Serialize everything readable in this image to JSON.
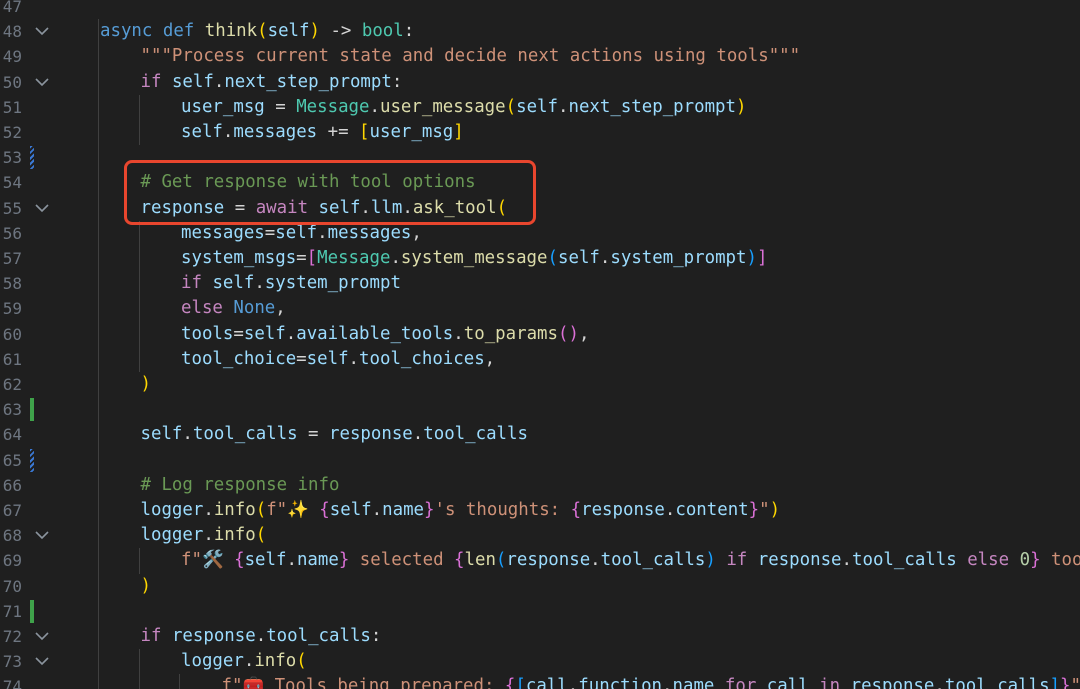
{
  "editor": {
    "language": "python",
    "colors": {
      "background": "#1f1f1f",
      "highlight_box": "#e8462e",
      "added_marker": "#3fa24a",
      "modified_marker": "#3a78d4"
    },
    "lines": [
      {
        "no": "47",
        "indent": 0,
        "fold": false,
        "marker": "",
        "tokens": []
      },
      {
        "no": "48",
        "indent": 0,
        "fold": true,
        "marker": "",
        "tokens": [
          {
            "t": "async",
            "c": "kw"
          },
          {
            "t": " "
          },
          {
            "t": "def",
            "c": "kw"
          },
          {
            "t": " "
          },
          {
            "t": "think",
            "c": "fn"
          },
          {
            "t": "(",
            "c": "b1"
          },
          {
            "t": "self",
            "c": "var"
          },
          {
            "t": ")",
            "c": "b1"
          },
          {
            "t": " -> "
          },
          {
            "t": "bool",
            "c": "cls"
          },
          {
            "t": ":"
          }
        ]
      },
      {
        "no": "49",
        "indent": 1,
        "fold": false,
        "marker": "",
        "tokens": [
          {
            "t": "\"\"\"Process current state and decide next actions using tools\"\"\"",
            "c": "str"
          }
        ]
      },
      {
        "no": "50",
        "indent": 1,
        "fold": true,
        "marker": "",
        "tokens": [
          {
            "t": "if",
            "c": "ctrl"
          },
          {
            "t": " "
          },
          {
            "t": "self",
            "c": "var"
          },
          {
            "t": "."
          },
          {
            "t": "next_step_prompt",
            "c": "var"
          },
          {
            "t": ":"
          }
        ]
      },
      {
        "no": "51",
        "indent": 2,
        "fold": false,
        "marker": "",
        "tokens": [
          {
            "t": "user_msg",
            "c": "var"
          },
          {
            "t": " = "
          },
          {
            "t": "Message",
            "c": "cls"
          },
          {
            "t": "."
          },
          {
            "t": "user_message",
            "c": "fn"
          },
          {
            "t": "(",
            "c": "b1"
          },
          {
            "t": "self",
            "c": "var"
          },
          {
            "t": "."
          },
          {
            "t": "next_step_prompt",
            "c": "var"
          },
          {
            "t": ")",
            "c": "b1"
          }
        ]
      },
      {
        "no": "52",
        "indent": 2,
        "fold": false,
        "marker": "",
        "tokens": [
          {
            "t": "self",
            "c": "var"
          },
          {
            "t": "."
          },
          {
            "t": "messages",
            "c": "var"
          },
          {
            "t": " += "
          },
          {
            "t": "[",
            "c": "b1"
          },
          {
            "t": "user_msg",
            "c": "var"
          },
          {
            "t": "]",
            "c": "b1"
          }
        ]
      },
      {
        "no": "53",
        "indent": 0,
        "fold": false,
        "marker": "modified",
        "tokens": []
      },
      {
        "no": "54",
        "indent": 1,
        "fold": false,
        "marker": "",
        "tokens": [
          {
            "t": "# Get response with tool options",
            "c": "cmt"
          }
        ]
      },
      {
        "no": "55",
        "indent": 1,
        "fold": true,
        "marker": "",
        "tokens": [
          {
            "t": "response",
            "c": "var"
          },
          {
            "t": " = "
          },
          {
            "t": "await",
            "c": "ctrl"
          },
          {
            "t": " "
          },
          {
            "t": "self",
            "c": "var"
          },
          {
            "t": "."
          },
          {
            "t": "llm",
            "c": "var"
          },
          {
            "t": "."
          },
          {
            "t": "ask_tool",
            "c": "fn"
          },
          {
            "t": "(",
            "c": "b1"
          }
        ]
      },
      {
        "no": "56",
        "indent": 2,
        "fold": false,
        "marker": "",
        "tokens": [
          {
            "t": "messages",
            "c": "var"
          },
          {
            "t": "="
          },
          {
            "t": "self",
            "c": "var"
          },
          {
            "t": "."
          },
          {
            "t": "messages",
            "c": "var"
          },
          {
            "t": ","
          }
        ]
      },
      {
        "no": "57",
        "indent": 2,
        "fold": false,
        "marker": "",
        "tokens": [
          {
            "t": "system_msgs",
            "c": "var"
          },
          {
            "t": "="
          },
          {
            "t": "[",
            "c": "b2"
          },
          {
            "t": "Message",
            "c": "cls"
          },
          {
            "t": "."
          },
          {
            "t": "system_message",
            "c": "fn"
          },
          {
            "t": "(",
            "c": "b3"
          },
          {
            "t": "self",
            "c": "var"
          },
          {
            "t": "."
          },
          {
            "t": "system_prompt",
            "c": "var"
          },
          {
            "t": ")",
            "c": "b3"
          },
          {
            "t": "]",
            "c": "b2"
          }
        ]
      },
      {
        "no": "58",
        "indent": 2,
        "fold": false,
        "marker": "",
        "tokens": [
          {
            "t": "if",
            "c": "ctrl"
          },
          {
            "t": " "
          },
          {
            "t": "self",
            "c": "var"
          },
          {
            "t": "."
          },
          {
            "t": "system_prompt",
            "c": "var"
          }
        ]
      },
      {
        "no": "59",
        "indent": 2,
        "fold": false,
        "marker": "",
        "tokens": [
          {
            "t": "else",
            "c": "ctrl"
          },
          {
            "t": " "
          },
          {
            "t": "None",
            "c": "kw"
          },
          {
            "t": ","
          }
        ]
      },
      {
        "no": "60",
        "indent": 2,
        "fold": false,
        "marker": "",
        "tokens": [
          {
            "t": "tools",
            "c": "var"
          },
          {
            "t": "="
          },
          {
            "t": "self",
            "c": "var"
          },
          {
            "t": "."
          },
          {
            "t": "available_tools",
            "c": "var"
          },
          {
            "t": "."
          },
          {
            "t": "to_params",
            "c": "fn"
          },
          {
            "t": "(",
            "c": "b2"
          },
          {
            "t": ")",
            "c": "b2"
          },
          {
            "t": ","
          }
        ]
      },
      {
        "no": "61",
        "indent": 2,
        "fold": false,
        "marker": "",
        "tokens": [
          {
            "t": "tool_choice",
            "c": "var"
          },
          {
            "t": "="
          },
          {
            "t": "self",
            "c": "var"
          },
          {
            "t": "."
          },
          {
            "t": "tool_choices",
            "c": "var"
          },
          {
            "t": ","
          }
        ]
      },
      {
        "no": "62",
        "indent": 1,
        "fold": false,
        "marker": "",
        "tokens": [
          {
            "t": ")",
            "c": "b1"
          }
        ]
      },
      {
        "no": "63",
        "indent": 0,
        "fold": false,
        "marker": "added",
        "tokens": []
      },
      {
        "no": "64",
        "indent": 1,
        "fold": false,
        "marker": "",
        "tokens": [
          {
            "t": "self",
            "c": "var"
          },
          {
            "t": "."
          },
          {
            "t": "tool_calls",
            "c": "var"
          },
          {
            "t": " = "
          },
          {
            "t": "response",
            "c": "var"
          },
          {
            "t": "."
          },
          {
            "t": "tool_calls",
            "c": "var"
          }
        ]
      },
      {
        "no": "65",
        "indent": 0,
        "fold": false,
        "marker": "modified",
        "tokens": []
      },
      {
        "no": "66",
        "indent": 1,
        "fold": false,
        "marker": "",
        "tokens": [
          {
            "t": "# Log response info",
            "c": "cmt"
          }
        ]
      },
      {
        "no": "67",
        "indent": 1,
        "fold": false,
        "marker": "",
        "tokens": [
          {
            "t": "logger",
            "c": "var"
          },
          {
            "t": "."
          },
          {
            "t": "info",
            "c": "fn"
          },
          {
            "t": "(",
            "c": "b1"
          },
          {
            "t": "f\"✨ ",
            "c": "str"
          },
          {
            "t": "{",
            "c": "b2"
          },
          {
            "t": "self",
            "c": "var"
          },
          {
            "t": "."
          },
          {
            "t": "name",
            "c": "var"
          },
          {
            "t": "}",
            "c": "b2"
          },
          {
            "t": "'s thoughts: ",
            "c": "str"
          },
          {
            "t": "{",
            "c": "b2"
          },
          {
            "t": "response",
            "c": "var"
          },
          {
            "t": "."
          },
          {
            "t": "content",
            "c": "var"
          },
          {
            "t": "}",
            "c": "b2"
          },
          {
            "t": "\"",
            "c": "str"
          },
          {
            "t": ")",
            "c": "b1"
          }
        ]
      },
      {
        "no": "68",
        "indent": 1,
        "fold": true,
        "marker": "",
        "tokens": [
          {
            "t": "logger",
            "c": "var"
          },
          {
            "t": "."
          },
          {
            "t": "info",
            "c": "fn"
          },
          {
            "t": "(",
            "c": "b1"
          }
        ]
      },
      {
        "no": "69",
        "indent": 2,
        "fold": false,
        "marker": "",
        "tokens": [
          {
            "t": "f\"🛠️ ",
            "c": "str"
          },
          {
            "t": "{",
            "c": "b2"
          },
          {
            "t": "self",
            "c": "var"
          },
          {
            "t": "."
          },
          {
            "t": "name",
            "c": "var"
          },
          {
            "t": "}",
            "c": "b2"
          },
          {
            "t": " selected ",
            "c": "str"
          },
          {
            "t": "{",
            "c": "b2"
          },
          {
            "t": "len",
            "c": "fn"
          },
          {
            "t": "(",
            "c": "b3"
          },
          {
            "t": "response",
            "c": "var"
          },
          {
            "t": "."
          },
          {
            "t": "tool_calls",
            "c": "var"
          },
          {
            "t": ")",
            "c": "b3"
          },
          {
            "t": " "
          },
          {
            "t": "if",
            "c": "ctrl"
          },
          {
            "t": " "
          },
          {
            "t": "response",
            "c": "var"
          },
          {
            "t": "."
          },
          {
            "t": "tool_calls",
            "c": "var"
          },
          {
            "t": " "
          },
          {
            "t": "else",
            "c": "ctrl"
          },
          {
            "t": " "
          },
          {
            "t": "0",
            "c": "num"
          },
          {
            "t": "}",
            "c": "b2"
          },
          {
            "t": " tools t",
            "c": "str"
          }
        ]
      },
      {
        "no": "70",
        "indent": 1,
        "fold": false,
        "marker": "",
        "tokens": [
          {
            "t": ")",
            "c": "b1"
          }
        ]
      },
      {
        "no": "71",
        "indent": 0,
        "fold": false,
        "marker": "added",
        "tokens": []
      },
      {
        "no": "72",
        "indent": 1,
        "fold": true,
        "marker": "",
        "tokens": [
          {
            "t": "if",
            "c": "ctrl"
          },
          {
            "t": " "
          },
          {
            "t": "response",
            "c": "var"
          },
          {
            "t": "."
          },
          {
            "t": "tool_calls",
            "c": "var"
          },
          {
            "t": ":"
          }
        ]
      },
      {
        "no": "73",
        "indent": 2,
        "fold": true,
        "marker": "",
        "tokens": [
          {
            "t": "logger",
            "c": "var"
          },
          {
            "t": "."
          },
          {
            "t": "info",
            "c": "fn"
          },
          {
            "t": "(",
            "c": "b1"
          }
        ]
      },
      {
        "no": "74",
        "indent": 3,
        "fold": false,
        "marker": "",
        "tokens": [
          {
            "t": "f\"🧰 Tools being prepared: ",
            "c": "str"
          },
          {
            "t": "{",
            "c": "b2"
          },
          {
            "t": "[",
            "c": "b3"
          },
          {
            "t": "call",
            "c": "var"
          },
          {
            "t": "."
          },
          {
            "t": "function",
            "c": "var"
          },
          {
            "t": "."
          },
          {
            "t": "name",
            "c": "var"
          },
          {
            "t": " "
          },
          {
            "t": "for",
            "c": "ctrl"
          },
          {
            "t": " "
          },
          {
            "t": "call",
            "c": "var"
          },
          {
            "t": " "
          },
          {
            "t": "in",
            "c": "ctrl"
          },
          {
            "t": " "
          },
          {
            "t": "response",
            "c": "var"
          },
          {
            "t": "."
          },
          {
            "t": "tool_calls",
            "c": "var"
          },
          {
            "t": "]",
            "c": "b3"
          },
          {
            "t": "}",
            "c": "b2"
          },
          {
            "t": "\"",
            "c": "str"
          }
        ]
      }
    ]
  }
}
